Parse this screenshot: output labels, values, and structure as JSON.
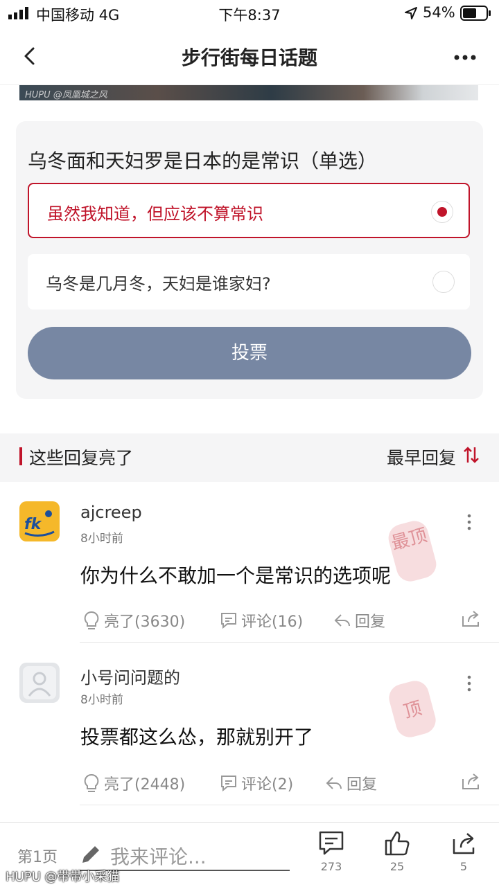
{
  "status_bar": {
    "carrier": "中国移动 4G",
    "time": "下午8:37",
    "battery": "54%"
  },
  "nav": {
    "title": "步行街每日话题"
  },
  "image_strip": {
    "watermark": "HUPU @凤凰城之风"
  },
  "poll": {
    "question": "乌冬面和天妇罗是日本的是常识（单选）",
    "options": [
      {
        "label": "虽然我知道，但应该不算常识",
        "selected": true
      },
      {
        "label": "乌冬是几月冬，天妇是谁家妇?",
        "selected": false
      }
    ],
    "vote_label": "投票"
  },
  "section": {
    "title": "这些回复亮了",
    "sort_label": "最早回复"
  },
  "comments": [
    {
      "username": "ajcreep",
      "time": "8小时前",
      "body": "你为什么不敢加一个是常识的选项呢",
      "stamp": "最顶",
      "likes": "亮了(3630)",
      "comments": "评论(16)",
      "reply": "回复"
    },
    {
      "username": "小号问问题的",
      "time": "8小时前",
      "body": "投票都这么怂，那就别开了",
      "stamp": "顶",
      "likes": "亮了(2448)",
      "comments": "评论(2)",
      "reply": "回复"
    }
  ],
  "bottom_bar": {
    "page_label": "第1页",
    "comment_placeholder": "我来评论...",
    "comment_count": "273",
    "like_count": "25",
    "share_count": "5"
  },
  "watermark": "HUPU @带带小采猫",
  "colors": {
    "accent": "#c0142a",
    "vote_button": "#7787a3"
  }
}
